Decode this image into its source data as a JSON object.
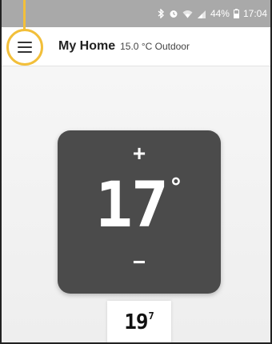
{
  "status_bar": {
    "battery": "44%",
    "time": "17:04"
  },
  "app_bar": {
    "menu_icon": "hamburger-menu-icon",
    "home_name": "My Home",
    "outdoor_text": "15.0 °C Outdoor"
  },
  "thermostat": {
    "increase_label": "+",
    "decrease_label": "−",
    "setpoint": "17",
    "setpoint_unit": "°"
  },
  "current": {
    "value": "19",
    "decimal": "7"
  },
  "colors": {
    "callout": "#f2bf3a",
    "thermostat_body": "#4b4b4b",
    "status_bar": "#a9a9a9"
  }
}
